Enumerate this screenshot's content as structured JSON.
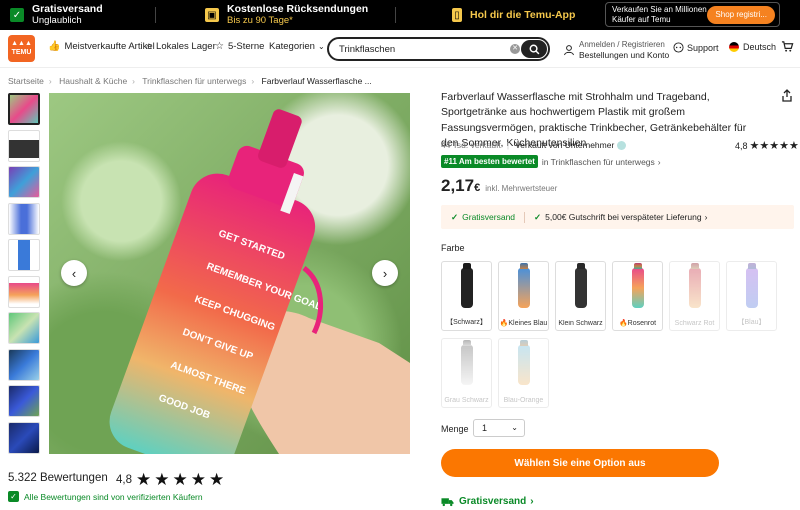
{
  "promo": {
    "free_shipping_title": "Gratisversand",
    "free_shipping_sub": "Unglaublich",
    "returns_title": "Kostenlose Rücksendungen",
    "returns_sub": "Bis zu 90 Tage*",
    "app_text": "Hol dir die Temu-App",
    "seller_text": "Verkaufen Sie an Millionen Käufer auf Temu",
    "seller_button": "Shop registri..."
  },
  "header": {
    "logo": "TEMU",
    "nav": [
      "Meistverkaufte Artikel",
      "Lokales Lager",
      "5-Sterne",
      "Kategorien"
    ],
    "search_value": "Trinkflaschen",
    "account_line1": "Anmelden / Registrieren",
    "account_line2": "Bestellungen und Konto",
    "support": "Support",
    "language": "Deutsch"
  },
  "breadcrumb": [
    "Startseite",
    "Haushalt & Küche",
    "Trinkflaschen für unterwegs",
    "Farbverlauf Wasserflasche ..."
  ],
  "product": {
    "title": "Farbverlauf Wasserflasche mit Strohhalm und Trageband, Sportgetränke aus hochwertigem Plastik mit großem Fassungsvermögen, praktische Trinkbecher, Getränkebehälter für den Sommer, Küchenutensilien",
    "sold": "44 Tsd. verkauft",
    "seller": "Verkauft von Unternehmer",
    "rating": "4,8",
    "stars": "★★★★★",
    "rank_badge": "#11 Am besten bewertet",
    "rank_text": "in Trinkflaschen für unterwegs",
    "price_main": "2,17",
    "price_currency": "€",
    "price_note": "inkl. Mehrwertsteuer",
    "ship_free": "Gratisversand",
    "ship_credit": "5,00€ Gutschrift bei verspäteter Lieferung",
    "color_label": "Farbe",
    "qty_label": "Menge",
    "qty_value": "1",
    "cta": "Wählen Sie eine Option aus",
    "bottom_ship": "Gratisversand"
  },
  "swatches": [
    {
      "name": "【Schwarz】",
      "color": "#222222",
      "disabled": false
    },
    {
      "name": "Kleines Blau",
      "color": "#4a90d9",
      "disabled": false,
      "fire": true
    },
    {
      "name": "Klein Schwarz",
      "color": "#333333",
      "disabled": false
    },
    {
      "name": "Rosenrot",
      "color": "#e84a8a",
      "disabled": false,
      "fire": true
    },
    {
      "name": "Schwarz Rot",
      "color": "#d76a7a",
      "disabled": true
    },
    {
      "name": "【Blau】",
      "color": "#8ea6e8",
      "disabled": true
    },
    {
      "name": "Grau Schwarz",
      "color": "#c8c8c8",
      "disabled": true
    },
    {
      "name": "Blau-Orange",
      "color": "#9ad0e8",
      "disabled": true
    }
  ],
  "reviews": {
    "count": "5.322 Bewertungen",
    "rating": "4,8",
    "stars": "★★★★★",
    "verified": "Alle Bewertungen sind von verifizierten Käufern"
  },
  "icons": {
    "prev": "‹",
    "next": "›",
    "share": "⇪",
    "search": "⌕"
  }
}
